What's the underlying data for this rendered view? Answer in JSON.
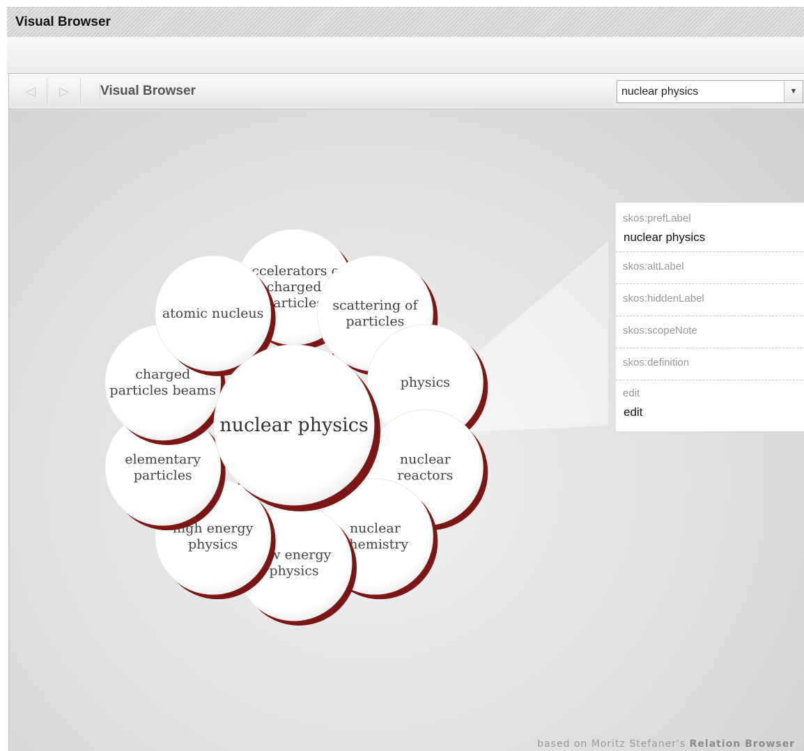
{
  "window": {
    "title": "Visual Browser"
  },
  "toolbar": {
    "title": "Visual Browser",
    "back_icon": "◁",
    "forward_icon": "▷",
    "search_value": "nuclear physics",
    "dropdown_icon": "▼"
  },
  "graph": {
    "center": "nuclear physics",
    "nodes": [
      {
        "lines": [
          "accelerators of",
          "charged",
          "particles"
        ],
        "relation": "B",
        "color": "#8b1a1a"
      },
      {
        "lines": [
          "scattering of",
          "particles"
        ],
        "relation": "N",
        "color": "#8b1a1a"
      },
      {
        "lines": [
          "physics"
        ],
        "relation": "B",
        "color": "#8b1a1a"
      },
      {
        "lines": [
          "nuclear",
          "reactors"
        ],
        "relation": "R",
        "color": "#1f8fc4"
      },
      {
        "lines": [
          "nuclear",
          "chemistry"
        ],
        "relation": "R",
        "color": "#1f8fc4"
      },
      {
        "lines": [
          "low energy",
          "physics"
        ],
        "relation": "B",
        "color": "#8b1a1a"
      },
      {
        "lines": [
          "high energy",
          "physics"
        ],
        "relation": "B",
        "color": "#8b1a1a"
      },
      {
        "lines": [
          "elementary",
          "particles"
        ],
        "relation": "B",
        "color": "#8b1a1a"
      },
      {
        "lines": [
          "charged",
          "particles beams"
        ],
        "relation": "B",
        "color": "#8b1a1a"
      },
      {
        "lines": [
          "atomic nucleus"
        ],
        "relation": "B",
        "color": "#8b1a1a"
      }
    ]
  },
  "details": {
    "pref_label": "skos:prefLabel",
    "pref_value": "nuclear physics",
    "alt_label": "skos:altLabel",
    "hidden_label": "skos:hiddenLabel",
    "scope_note": "skos:scopeNote",
    "definition": "skos:definition",
    "edit_label": "edit",
    "edit_value": "edit"
  },
  "footer": {
    "prefix": "based on Moritz Stefaner's",
    "brand": "Relation Browser"
  },
  "colors": {
    "broader": "#8b1a1a",
    "related": "#1f8fc4"
  }
}
